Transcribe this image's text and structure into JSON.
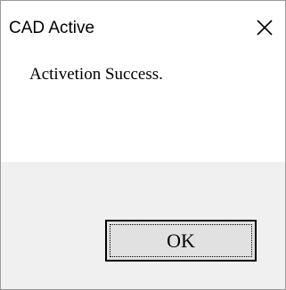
{
  "window": {
    "title": "CAD Active",
    "close_icon": "close-icon"
  },
  "dialog": {
    "message": "Activetion Success.",
    "ok_label": "OK"
  },
  "colors": {
    "footer_bg": "#f0f0f0",
    "button_bg": "#e1e1e1"
  }
}
